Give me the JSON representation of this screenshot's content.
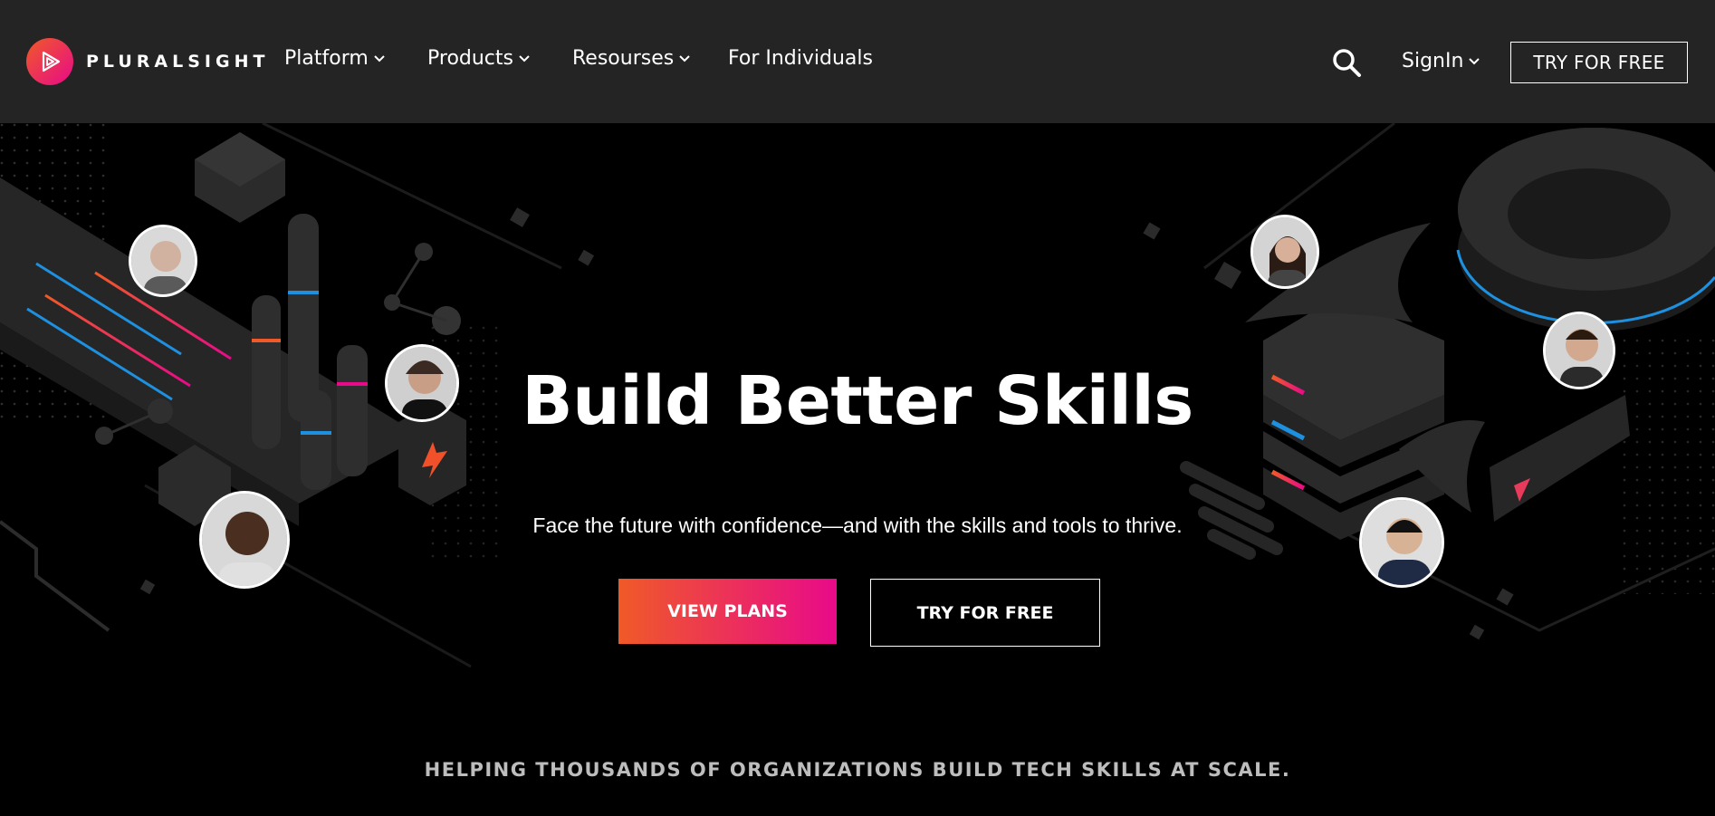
{
  "brand": {
    "name": "PLURALSIGHT"
  },
  "nav": {
    "items": [
      {
        "label": "Platform",
        "has_dropdown": true
      },
      {
        "label": "Products",
        "has_dropdown": true
      },
      {
        "label": "Resourses",
        "has_dropdown": true
      },
      {
        "label": "For Individuals",
        "has_dropdown": false
      }
    ],
    "signin_label": "SignIn",
    "try_label": "TRY FOR FREE"
  },
  "hero": {
    "headline": "Build Better Skills",
    "subheadline": "Face the future with confidence—and with the skills and tools to thrive.",
    "primary_button": "VIEW PLANS",
    "secondary_button": "TRY FOR FREE"
  },
  "logos_strip": {
    "tagline": "HELPING THOUSANDS OF ORGANIZATIONS BUILD TECH SKILLS AT SCALE."
  },
  "colors": {
    "nav_bg": "#242424",
    "hero_bg": "#000000",
    "accent_start": "#f05a28",
    "accent_end": "#e80a89",
    "blue_stripe": "#1e90e0"
  }
}
